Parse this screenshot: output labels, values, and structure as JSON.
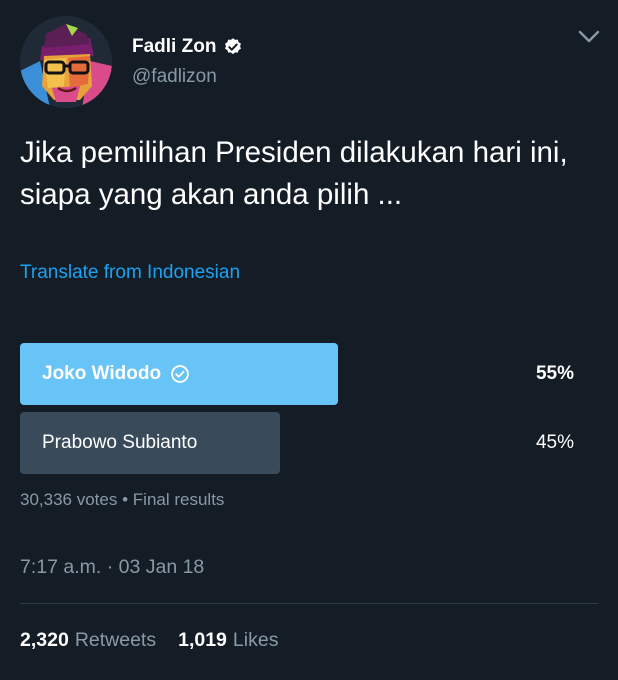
{
  "author": {
    "name": "Fadli Zon",
    "handle": "@fadlizon"
  },
  "icons": {
    "verified": "verified-badge-icon",
    "menu": "chevron-down-icon",
    "selected": "check-circle-icon"
  },
  "tweet": {
    "text": "Jika pemilihan Presiden dilakukan hari ini, siapa yang akan anda pilih ...",
    "translate_label": "Translate from Indonesian"
  },
  "poll": {
    "options": [
      {
        "label": "Joko Widodo",
        "percent_label": "55%",
        "percent": 55,
        "winner": true
      },
      {
        "label": "Prabowo Subianto",
        "percent_label": "45%",
        "percent": 45,
        "winner": false
      }
    ],
    "votes": "30,336 votes",
    "separator": "•",
    "status": "Final results"
  },
  "timestamp": "7:17 a.m. · 03 Jan 18",
  "stats": {
    "retweets_count": "2,320",
    "retweets_label": "Retweets",
    "likes_count": "1,019",
    "likes_label": "Likes"
  },
  "colors": {
    "background": "#141d26",
    "accent": "#1da1f2",
    "winner_bar": "#68c3f7",
    "loser_bar": "#394b5b",
    "secondary_text": "#8899a6"
  }
}
